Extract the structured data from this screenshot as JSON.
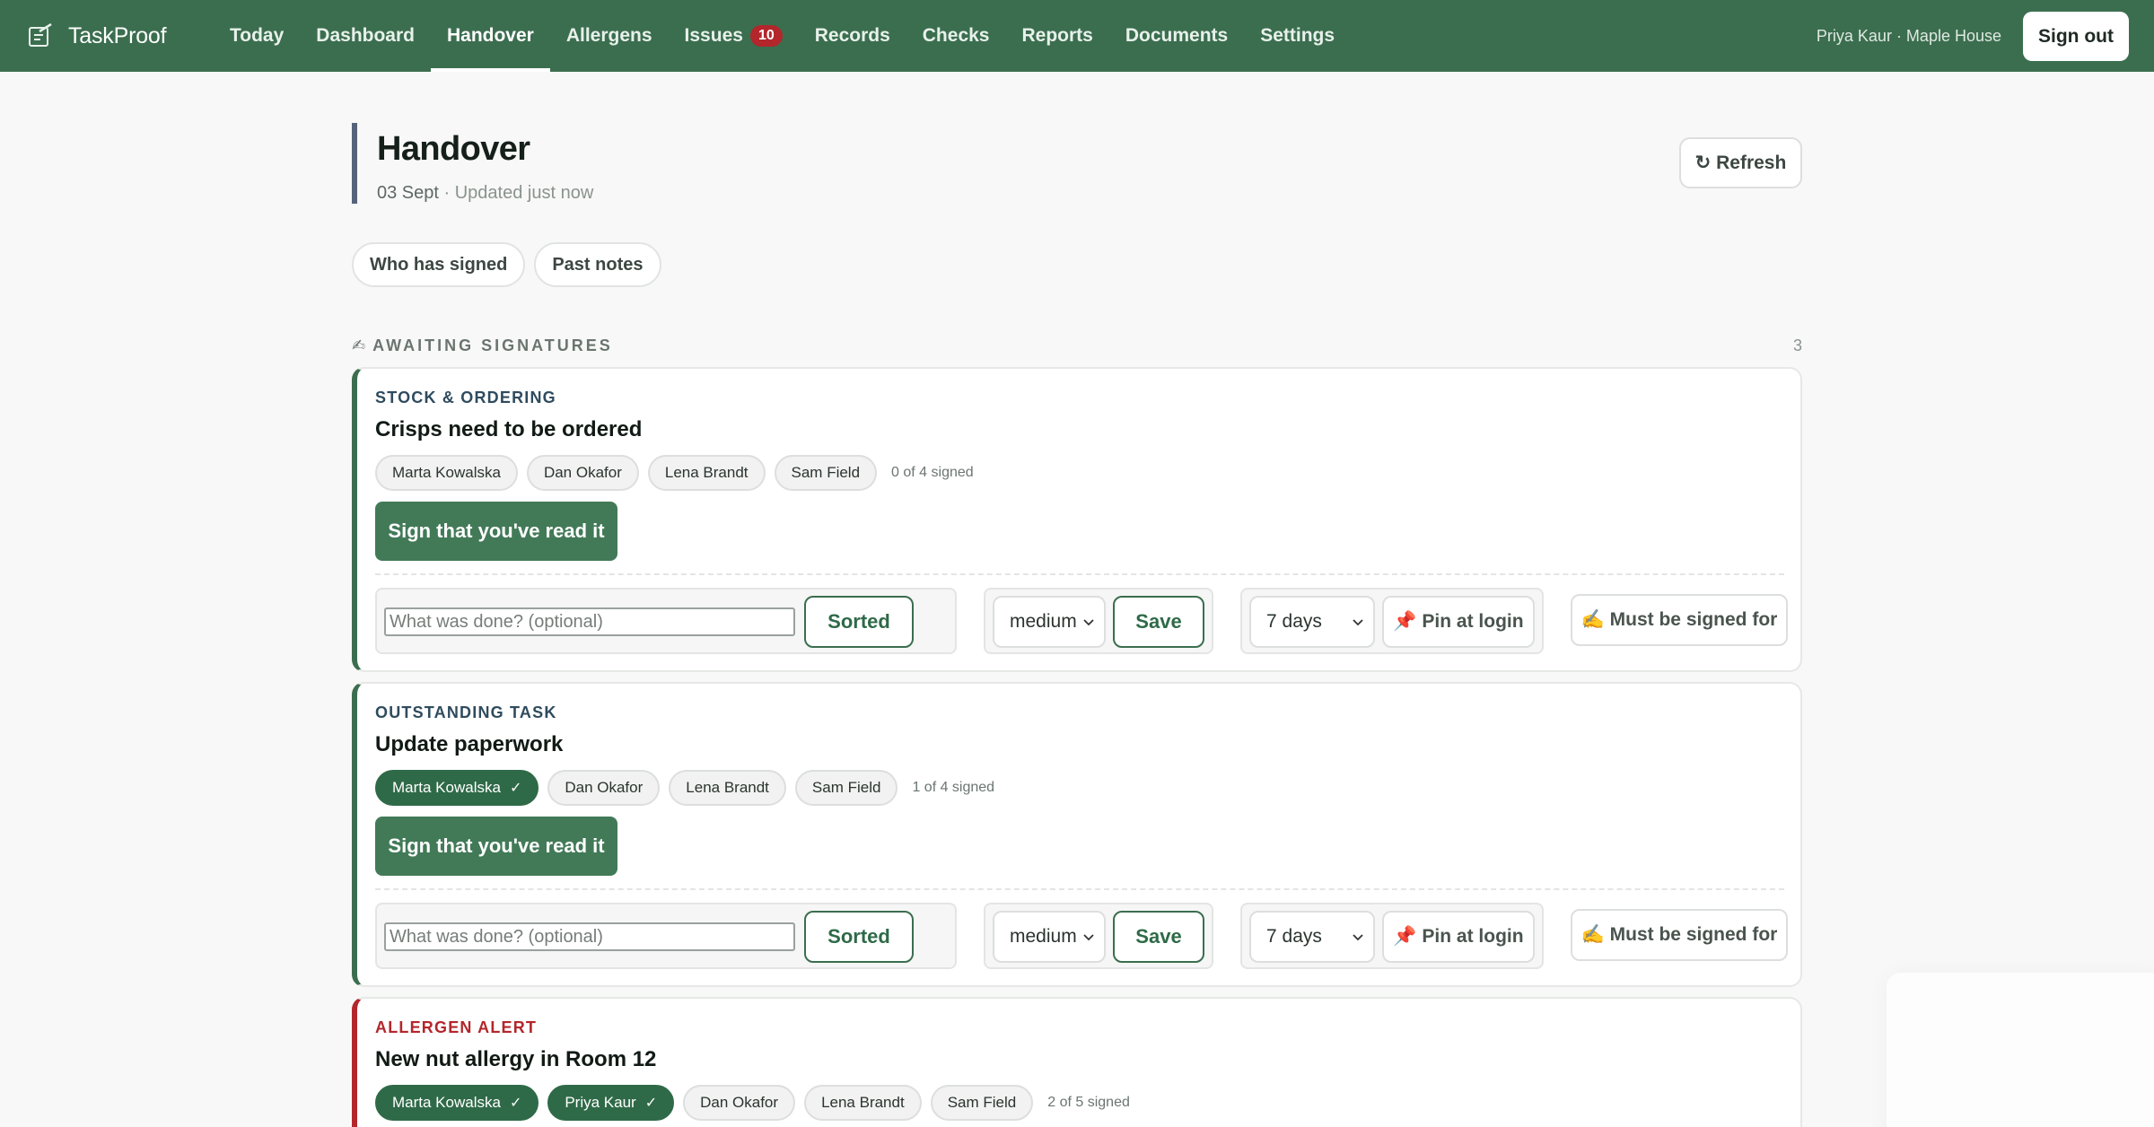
{
  "app": {
    "name": "TaskProof"
  },
  "nav": {
    "items": [
      {
        "label": "Today"
      },
      {
        "label": "Dashboard"
      },
      {
        "label": "Handover"
      },
      {
        "label": "Allergens"
      },
      {
        "label": "Issues",
        "badge": "10"
      },
      {
        "label": "Records"
      },
      {
        "label": "Checks"
      },
      {
        "label": "Reports"
      },
      {
        "label": "Documents"
      },
      {
        "label": "Settings"
      }
    ],
    "active": "Handover"
  },
  "user": {
    "info": "Priya Kaur · Maple House",
    "signout_label": "Sign out"
  },
  "page": {
    "title": "Handover",
    "date": "03 Sept",
    "updated": " · Updated just now",
    "refresh_label": "↻ Refresh",
    "tabs": [
      {
        "label": "Who has signed"
      },
      {
        "label": "Past notes"
      }
    ]
  },
  "section": {
    "icon": "✍",
    "label": "AWAITING SIGNATURES",
    "count": "3"
  },
  "cards": [
    {
      "category": "STOCK & ORDERING",
      "title": "Crisps need to be ordered",
      "people": [
        {
          "name": "Marta Kowalska",
          "signed": false
        },
        {
          "name": "Dan Okafor",
          "signed": false
        },
        {
          "name": "Lena Brandt",
          "signed": false
        },
        {
          "name": "Sam Field",
          "signed": false
        }
      ],
      "signed_count": "0 of 4 signed",
      "sign_label": "Sign that you've read it",
      "note_placeholder": "What was done? (optional)",
      "sorted_label": "Sorted",
      "priority": "medium",
      "save_label": "Save",
      "duration": "7 days",
      "pin_label": "📌 Pin at login",
      "must_label": "✍ Must be signed for"
    },
    {
      "category": "OUTSTANDING TASK",
      "title": "Update paperwork",
      "people": [
        {
          "name": "Marta Kowalska",
          "signed": true
        },
        {
          "name": "Dan Okafor",
          "signed": false
        },
        {
          "name": "Lena Brandt",
          "signed": false
        },
        {
          "name": "Sam Field",
          "signed": false
        }
      ],
      "signed_count": "1 of 4 signed",
      "sign_label": "Sign that you've read it",
      "note_placeholder": "What was done? (optional)",
      "sorted_label": "Sorted",
      "priority": "medium",
      "save_label": "Save",
      "duration": "7 days",
      "pin_label": "📌 Pin at login",
      "must_label": "✍ Must be signed for"
    },
    {
      "category": "ALLERGEN ALERT",
      "title": "New nut allergy in Room 12",
      "people": [
        {
          "name": "Marta Kowalska",
          "signed": true
        },
        {
          "name": "Priya Kaur",
          "signed": true
        },
        {
          "name": "Dan Okafor",
          "signed": false
        },
        {
          "name": "Lena Brandt",
          "signed": false
        },
        {
          "name": "Sam Field",
          "signed": false
        }
      ],
      "signed_count": "2 of 5 signed"
    }
  ],
  "colors": {
    "brand": "#3b6e4f",
    "alert": "#b3262b",
    "header_accent": "#55637a"
  },
  "icons": {
    "logo": "clipboard-check-icon",
    "chevron": "chevron-down-icon",
    "tick": "check-icon"
  }
}
